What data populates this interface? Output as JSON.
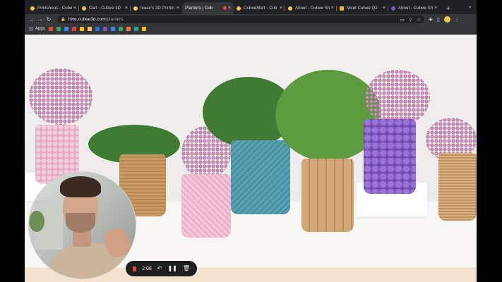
{
  "browser": {
    "tabs": [
      {
        "title": "Printshops - Cubee",
        "active": false
      },
      {
        "title": "Cart - Cubee 3D",
        "active": false
      },
      {
        "title": "Isaac's 3D Printin",
        "active": false
      },
      {
        "title": "Planters | Cub",
        "active": true,
        "recording": true
      },
      {
        "title": "CubeeMart - Cub",
        "active": false
      },
      {
        "title": "About - Cubee Sh",
        "active": false
      },
      {
        "title": "Meet Cubee Q2",
        "active": false
      },
      {
        "title": "About - Cubee Sh",
        "active": false
      }
    ],
    "new_tab_label": "+",
    "url_host": "hive.cubee3d.com",
    "url_path": "/planters",
    "bookmarks_apps_label": "Apps",
    "bookmark_colors": [
      "#e8453c",
      "#34a853",
      "#4285f4",
      "#ea4335",
      "#fbbc04",
      "#f2c94c",
      "#1a73e8",
      "#7e57c2",
      "#4285f4",
      "#34a853",
      "#ff7043",
      "#26a69a",
      "#fbbc04"
    ]
  },
  "recorder": {
    "elapsed": "2:08"
  },
  "colors": {
    "accent_record": "#e8453c",
    "chrome_dark": "#202124",
    "chrome_toolbar": "#35363a"
  }
}
